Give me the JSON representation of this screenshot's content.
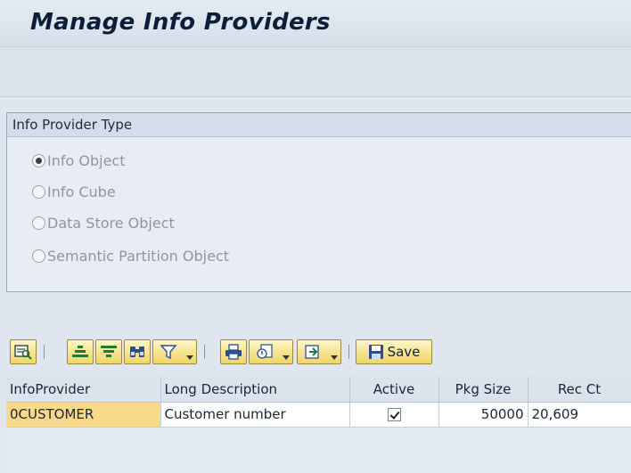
{
  "header": {
    "title": "Manage Info Providers"
  },
  "provider_type": {
    "heading": "Info Provider Type",
    "options": [
      {
        "label": "Info Object",
        "selected": true
      },
      {
        "label": "Info Cube",
        "selected": false
      },
      {
        "label": "Data Store Object",
        "selected": false
      },
      {
        "label": "Semantic Partition Object",
        "selected": false
      }
    ]
  },
  "toolbar": {
    "save_label": "Save",
    "icons": [
      "details-icon",
      "sort-ascending-icon",
      "sort-descending-icon",
      "find-icon",
      "filter-icon",
      "print-icon",
      "export-icon",
      "layout-icon",
      "save-icon"
    ]
  },
  "table": {
    "columns": [
      "InfoProvider",
      "Long Description",
      "Active",
      "Pkg Size",
      "Rec Ct"
    ],
    "rows": [
      {
        "infoprovider": "0CUSTOMER",
        "description": "Customer number",
        "active": true,
        "pkg_size": "50000",
        "rec_ct": "20,609"
      }
    ]
  },
  "colors": {
    "button_fill": "#f6e38e",
    "key_cell": "#f8d98a",
    "background": "#dfe6ef"
  }
}
